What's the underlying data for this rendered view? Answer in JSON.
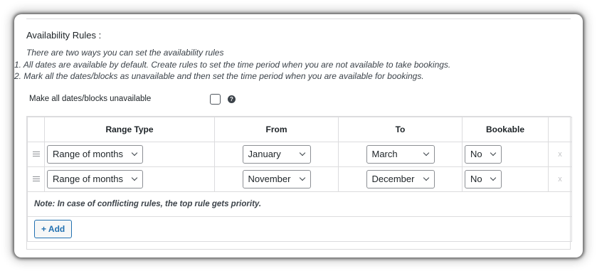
{
  "section": {
    "title": "Availability Rules :",
    "instructions": [
      "There are two ways you can set the availability rules",
      "1. All dates are available by default. Create rules to set the time period when you are not available to take bookings.",
      "2. Mark all the dates/blocks as unavailable and then set the time period when you are available for bookings."
    ]
  },
  "toggle": {
    "label": "Make all dates/blocks unavailable",
    "checked": false,
    "help_icon": "question-circle-icon"
  },
  "table": {
    "headers": [
      "Range Type",
      "From",
      "To",
      "Bookable"
    ],
    "rows": [
      {
        "range_type": "Range of months",
        "from": "January",
        "to": "March",
        "bookable": "No",
        "delete": "x"
      },
      {
        "range_type": "Range of months",
        "from": "November",
        "to": "December",
        "bookable": "No",
        "delete": "x"
      }
    ],
    "note": "Note: In case of conflicting rules, the top rule gets priority.",
    "add_label": "+ Add"
  },
  "colors": {
    "accent": "#2271b1",
    "border": "#dcdcde",
    "text": "#1d2327"
  }
}
